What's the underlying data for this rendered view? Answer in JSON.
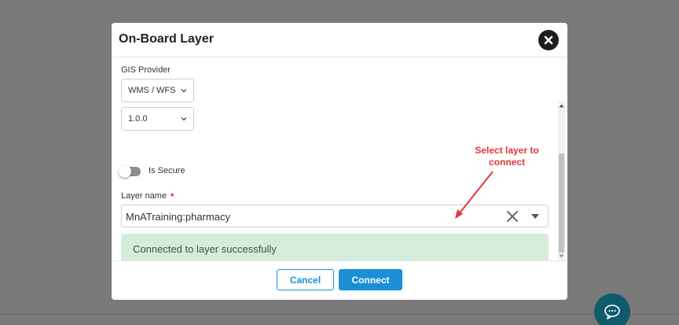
{
  "modal": {
    "title": "On-Board Layer"
  },
  "form": {
    "gis_provider_label": "GIS Provider",
    "provider_select_value": "WMS / WFS",
    "version_select_value": "1.0.0",
    "is_secure_label": "Is Secure",
    "is_secure_on": false,
    "layer_name_label": "Layer name",
    "required_marker": "*",
    "layer_name_value": "MnATraining:pharmacy",
    "success_message": "Connected to layer successfully"
  },
  "annotation": {
    "line1": "Select layer to",
    "line2": "connect"
  },
  "footer": {
    "cancel_label": "Cancel",
    "connect_label": "Connect"
  },
  "colors": {
    "primary": "#1a8fd6",
    "success_bg": "#d6ecdb",
    "success_text": "#2a5e37",
    "annotation": "#e0373c",
    "overlay": "#7a7a7a",
    "chat_fab": "#0f5b6b"
  },
  "icons": {
    "close": "close-circle-icon",
    "chevron": "chevron-down-icon",
    "clear": "clear-x-icon",
    "caret": "caret-down-icon",
    "chat": "chat-bubble-icon"
  }
}
